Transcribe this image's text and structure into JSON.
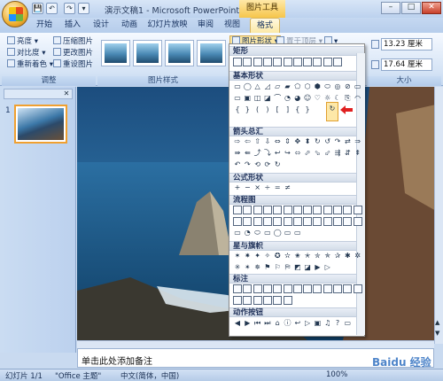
{
  "window": {
    "title": "演示文稿1 - Microsoft PowerPoint",
    "context_tab_group": "图片工具",
    "controls": [
      "–",
      "□",
      "✕"
    ]
  },
  "quick_access": [
    "💾",
    "↶",
    "↷",
    "▾"
  ],
  "tabs": [
    "开始",
    "插入",
    "设计",
    "动画",
    "幻灯片放映",
    "审阅",
    "视图",
    "格式"
  ],
  "active_tab": "格式",
  "ribbon": {
    "adjust_group": {
      "label": "调整",
      "buttons": [
        "亮度 ▾",
        "对比度 ▾",
        "重新着色 ▾",
        "压缩图片",
        "更改图片",
        "重设图片"
      ]
    },
    "picture_styles_group": {
      "label": "图片样式"
    },
    "shape_button": "图片形状 ▾",
    "bring_front_button": "置于顶层 ▾",
    "align_button": "▾",
    "size_group": {
      "label": "大小",
      "height": "13.23 厘米",
      "width": "17.64 厘米"
    }
  },
  "shape_dropdown": {
    "categories": [
      "矩形",
      "基本形状",
      "箭头总汇",
      "公式形状",
      "流程图",
      "星与旗帜",
      "标注",
      "动作按钮"
    ]
  },
  "left_panel": {
    "slide_number": "1"
  },
  "notes": {
    "placeholder": "单击此处添加备注"
  },
  "status_bar": {
    "slide_info": "幻灯片 1/1",
    "theme": "\"Office 主题\"",
    "language": "中文(简体，中国)",
    "zoom": "100%"
  },
  "watermark": "Baidu 经验"
}
